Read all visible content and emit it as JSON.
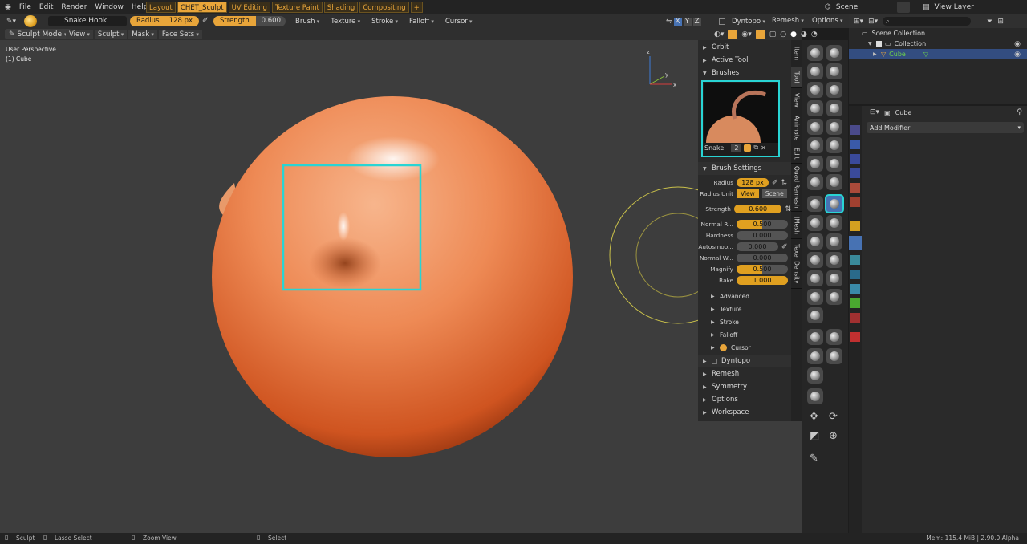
{
  "menu": {
    "items": [
      "File",
      "Edit",
      "Render",
      "Window",
      "Help"
    ]
  },
  "workspaces": {
    "tabs": [
      "Layout",
      "CHET_Sculpt",
      "UV Editing",
      "Texture Paint",
      "Shading",
      "Compositing"
    ],
    "add": "+"
  },
  "scene": {
    "label": "Scene",
    "view_layer": "View Layer"
  },
  "tool_header": {
    "brush_name": "Snake Hook",
    "radius_label": "Radius",
    "radius_value": "128 px",
    "strength_label": "Strength",
    "strength_value": "0.600",
    "menus": [
      "Brush",
      "Texture",
      "Stroke",
      "Falloff",
      "Cursor"
    ],
    "axes": [
      "X",
      "Y",
      "Z"
    ],
    "dyntopo": "Dyntopo",
    "remesh": "Remesh",
    "options": "Options"
  },
  "mode_header": {
    "mode": "Sculpt Mode",
    "menus": [
      "View",
      "Sculpt",
      "Mask",
      "Face Sets"
    ]
  },
  "viewport": {
    "perspective": "User Perspective",
    "object": "(1) Cube",
    "axis_x": "x",
    "axis_y": "y",
    "axis_z": "z"
  },
  "npanel": {
    "orbit": "Orbit",
    "active_tool": "Active Tool",
    "brushes": "Brushes",
    "brush_preview_name": "Snake",
    "brush_users": "2",
    "brush_settings": "Brush Settings",
    "radius": {
      "label": "Radius",
      "value": "128 px"
    },
    "radius_unit": {
      "label": "Radius Unit",
      "options": [
        "View",
        "Scene"
      ]
    },
    "strength": {
      "label": "Strength",
      "value": "0.600"
    },
    "normal_radius": {
      "label": "Normal R...",
      "value": "0.500",
      "fill": 0.5
    },
    "hardness": {
      "label": "Hardness",
      "value": "0.000",
      "fill": 0
    },
    "autosmooth": {
      "label": "Autosmoo...",
      "value": "0.000",
      "fill": 0
    },
    "normal_weight": {
      "label": "Normal W...",
      "value": "0.000",
      "fill": 0
    },
    "magnify": {
      "label": "Magnify",
      "value": "0.500",
      "fill": 0.5
    },
    "rake": {
      "label": "Rake",
      "value": "1.000",
      "fill": 1
    },
    "sub": [
      "Advanced",
      "Texture",
      "Stroke",
      "Falloff",
      "Cursor"
    ],
    "sections": [
      "Dyntopo",
      "Remesh",
      "Symmetry",
      "Options",
      "Workspace"
    ]
  },
  "vtabs": [
    "Item",
    "Tool",
    "View",
    "Animate",
    "Edit",
    "Quad Remesh",
    "JMesh",
    "Texel Density"
  ],
  "outliner": {
    "root": "Scene Collection",
    "collection": "Collection",
    "object": "Cube"
  },
  "properties": {
    "object": "Cube",
    "add_modifier": "Add Modifier"
  },
  "status": {
    "sculpt": "Sculpt",
    "lasso": "Lasso Select",
    "zoom": "Zoom View",
    "select": "Select",
    "mem": "Mem: 115.4 MiB | 2.90.0 Alpha"
  },
  "colors": {
    "accent": "#e8a53a",
    "highlight": "#29d4d4",
    "slider": "#e0a020",
    "object_green": "#6fd64a"
  }
}
